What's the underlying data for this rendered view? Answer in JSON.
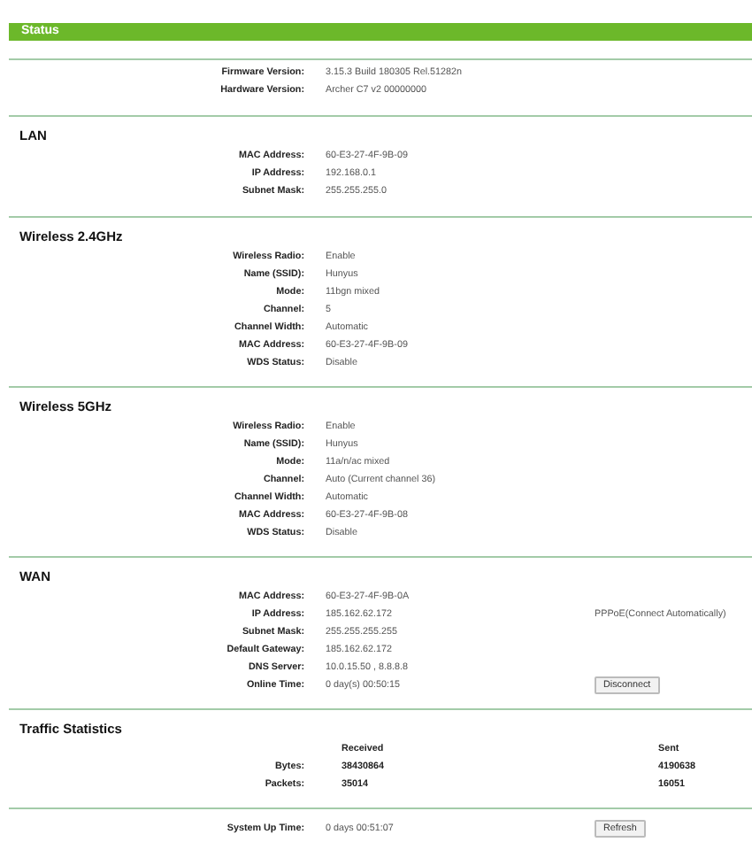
{
  "header": {
    "title": "Status"
  },
  "sections": [
    {
      "kind": "info",
      "rows": [
        {
          "label": "Firmware Version:",
          "value": "3.15.3 Build 180305 Rel.51282n"
        },
        {
          "label": "Hardware Version:",
          "value": "Archer C7 v2 00000000"
        }
      ]
    },
    {
      "kind": "info",
      "title": "LAN",
      "rows": [
        {
          "label": "MAC Address:",
          "value": "60-E3-27-4F-9B-09"
        },
        {
          "label": "IP Address:",
          "value": "192.168.0.1"
        },
        {
          "label": "Subnet Mask:",
          "value": "255.255.255.0"
        }
      ]
    },
    {
      "kind": "info",
      "title": "Wireless 2.4GHz",
      "rows": [
        {
          "label": "Wireless Radio:",
          "value": "Enable"
        },
        {
          "label": "Name (SSID):",
          "value": "Hunyus"
        },
        {
          "label": "Mode:",
          "value": "11bgn mixed"
        },
        {
          "label": "Channel:",
          "value": "5"
        },
        {
          "label": "Channel Width:",
          "value": "Automatic"
        },
        {
          "label": "MAC Address:",
          "value": "60-E3-27-4F-9B-09"
        },
        {
          "label": "WDS Status:",
          "value": "Disable"
        }
      ]
    },
    {
      "kind": "info",
      "title": "Wireless 5GHz",
      "rows": [
        {
          "label": "Wireless Radio:",
          "value": "Enable"
        },
        {
          "label": "Name (SSID):",
          "value": "Hunyus"
        },
        {
          "label": "Mode:",
          "value": "11a/n/ac mixed"
        },
        {
          "label": "Channel:",
          "value": "Auto (Current channel 36)"
        },
        {
          "label": "Channel Width:",
          "value": "Automatic"
        },
        {
          "label": "MAC Address:",
          "value": "60-E3-27-4F-9B-08"
        },
        {
          "label": "WDS Status:",
          "value": "Disable"
        }
      ]
    },
    {
      "kind": "info",
      "title": "WAN",
      "rows": [
        {
          "label": "MAC Address:",
          "value": "60-E3-27-4F-9B-0A"
        },
        {
          "label": "IP Address:",
          "value": "185.162.62.172",
          "extra": {
            "kind": "text",
            "text": "PPPoE(Connect Automatically)"
          }
        },
        {
          "label": "Subnet Mask:",
          "value": "255.255.255.255"
        },
        {
          "label": "Default Gateway:",
          "value": "185.162.62.172"
        },
        {
          "label": "DNS Server:",
          "value": "10.0.15.50 , 8.8.8.8"
        },
        {
          "label": "Online Time:",
          "value": "0 day(s) 00:50:15",
          "extra": {
            "kind": "button",
            "text": "Disconnect"
          }
        }
      ]
    },
    {
      "kind": "stats",
      "title": "Traffic Statistics",
      "columns": [
        "Received",
        "Sent"
      ],
      "rows": [
        {
          "label": "Bytes:",
          "values": [
            "38430864",
            "4190638"
          ]
        },
        {
          "label": "Packets:",
          "values": [
            "35014",
            "16051"
          ]
        }
      ]
    },
    {
      "kind": "info",
      "rows": [
        {
          "label": "System Up Time:",
          "value": "0 days 00:51:07",
          "extra": {
            "kind": "button",
            "text": "Refresh"
          }
        }
      ]
    }
  ]
}
